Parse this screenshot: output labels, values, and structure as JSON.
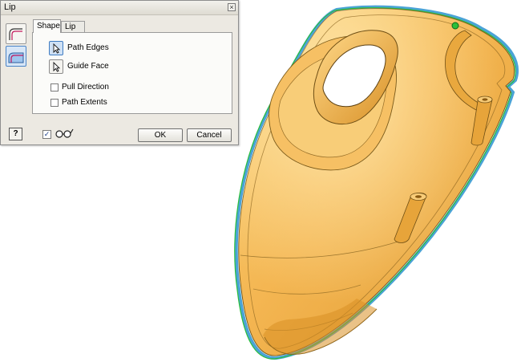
{
  "dialog": {
    "title": "Lip",
    "close_glyph": "×",
    "tabs": [
      {
        "label": "Shape",
        "active": true
      },
      {
        "label": "Lip",
        "active": false
      }
    ],
    "shape": {
      "path_edges_label": "Path Edges",
      "guide_face_label": "Guide Face",
      "pull_direction_label": "Pull Direction",
      "pull_direction_checked": false,
      "path_extents_label": "Path Extents",
      "path_extents_checked": false
    },
    "help_glyph": "?",
    "preview_checked": true,
    "preview_check_glyph": "✓",
    "ok_label": "OK",
    "cancel_label": "Cancel"
  },
  "icons": [
    "lip-type-icon",
    "groove-type-icon",
    "cursor-arrow-icon",
    "help-icon",
    "glasses-icon",
    "close-icon"
  ],
  "colors": {
    "model_fill": "#f2b550",
    "model_dark": "#c98522",
    "edge_highlight": "#4aa3d6",
    "edge_green": "#2bbf3a",
    "dialog_bg": "#ece9e2"
  }
}
